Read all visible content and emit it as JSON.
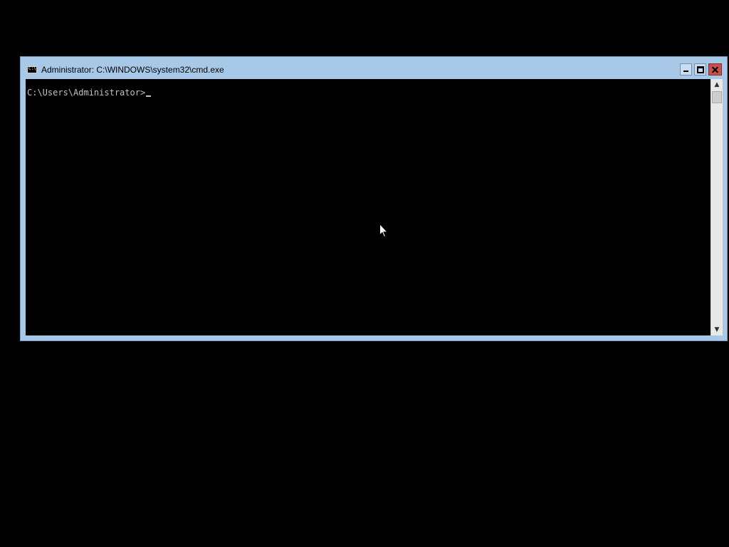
{
  "window": {
    "title": "Administrator: C:\\WINDOWS\\system32\\cmd.exe",
    "icon": "cmd-icon",
    "controls": {
      "minimize": "minimize-icon",
      "maximize": "maximize-icon",
      "close": "close-icon"
    }
  },
  "console": {
    "prompt": "C:\\Users\\Administrator>"
  },
  "scrollbar": {
    "up_arrow": "▲",
    "down_arrow": "▼"
  },
  "colors": {
    "desktop": "#000000",
    "window_frame": "#a8c8e8",
    "console_bg": "#000000",
    "console_text": "#c0c0c0",
    "close_button": "#c7504a"
  }
}
